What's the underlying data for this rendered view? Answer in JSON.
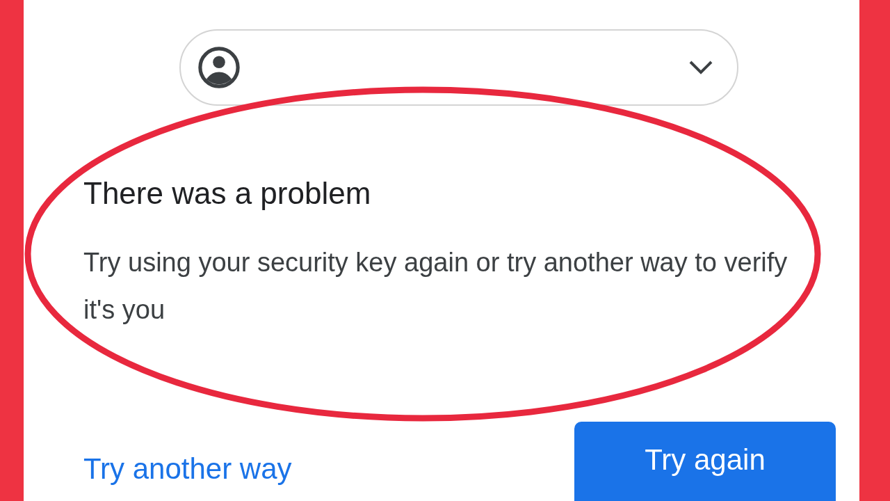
{
  "heading": "There was a problem",
  "message": "Try using your security key again or try another way to verify it's you",
  "actions": [
    {
      "label": "Try another way",
      "kind": "link"
    },
    {
      "label": "Try again",
      "kind": "primary"
    }
  ]
}
